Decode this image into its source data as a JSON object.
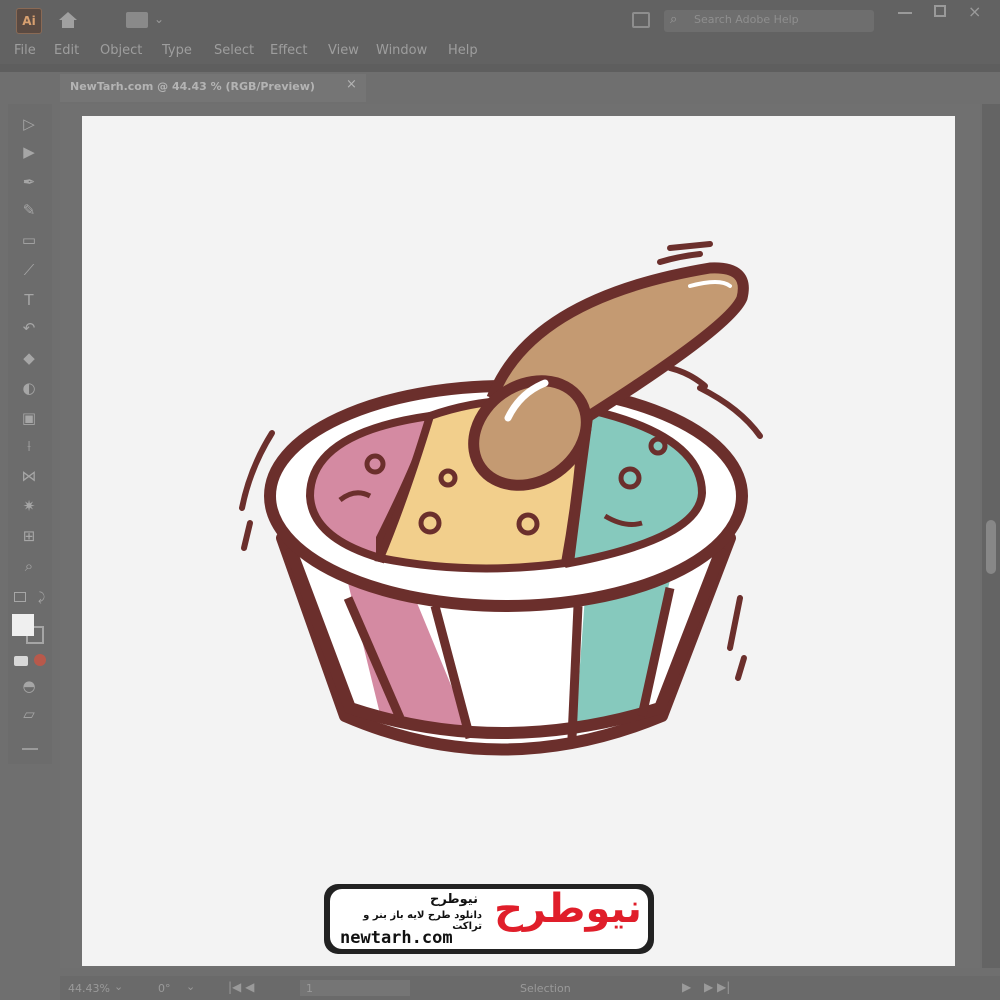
{
  "app": {
    "search_placeholder": "Search Adobe Help",
    "menu": [
      "File",
      "Edit",
      "Object",
      "Type",
      "Select",
      "Effect",
      "View",
      "Window",
      "Help"
    ]
  },
  "document": {
    "tab_label": "NewTarh.com @ 44.43 % (RGB/Preview)",
    "close_glyph": "×"
  },
  "status": {
    "zoom": "44.43%",
    "angle": "0°",
    "page": "1",
    "mode": "Selection"
  },
  "icons": {
    "tools": [
      "selection-tool-icon",
      "direct-selection-tool-icon",
      "pen-tool-icon",
      "curvature-tool-icon",
      "rectangle-tool-icon",
      "paintbrush-tool-icon",
      "type-tool-icon",
      "rotate-tool-icon",
      "eraser-tool-icon",
      "shape-builder-tool-icon",
      "gradient-tool-icon",
      "eyedropper-tool-icon",
      "blend-tool-icon",
      "symbol-sprayer-tool-icon",
      "artboard-tool-icon",
      "zoom-tool-icon"
    ]
  },
  "colors": {
    "pink": "#d48aa2",
    "yellow": "#f2cf8c",
    "teal": "#86c9bd",
    "outline": "#6b2f2c",
    "spoon": "#c49a72",
    "watermark_red": "#e01e2a"
  },
  "watermark": {
    "brand": "نیوطرح",
    "tagline": "دانلود طرح لایه باز بنر و تراکت",
    "url": "newtarh.com",
    "logo": "نیوطرح"
  }
}
